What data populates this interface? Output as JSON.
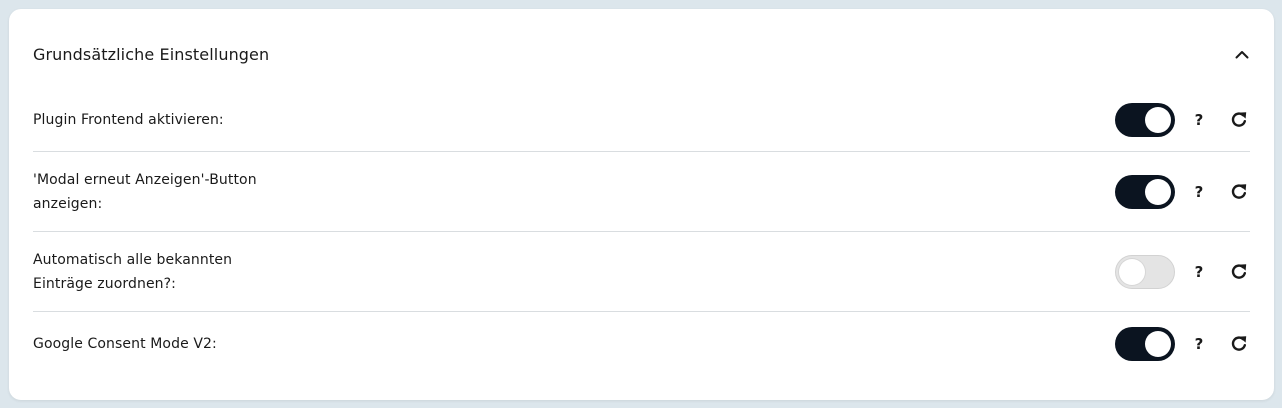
{
  "section": {
    "title": "Grundsätzliche Einstellungen",
    "collapse_icon": "chevron-up-icon"
  },
  "settings": [
    {
      "label": "Plugin Frontend aktivieren:",
      "enabled": true,
      "help_label": "?",
      "reset_icon": "reset-icon"
    },
    {
      "label": "'Modal erneut Anzeigen'-Button anzeigen:",
      "enabled": true,
      "help_label": "?",
      "reset_icon": "reset-icon"
    },
    {
      "label": "Automatisch alle bekannten Einträge zuordnen?:",
      "enabled": false,
      "help_label": "?",
      "reset_icon": "reset-icon"
    },
    {
      "label": "Google Consent Mode V2:",
      "enabled": true,
      "help_label": "?",
      "reset_icon": "reset-icon"
    }
  ],
  "colors": {
    "toggle_on": "#0b1420",
    "toggle_off": "#e4e4e4",
    "page_background": "#dce6ec",
    "card_background": "#ffffff"
  }
}
